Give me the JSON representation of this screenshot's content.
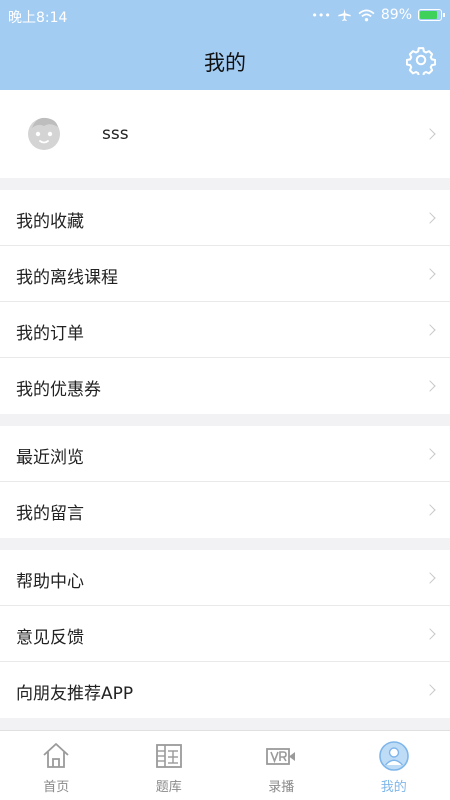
{
  "status_bar": {
    "time": "晚上8:14",
    "dots": "•••",
    "battery": "89%",
    "battery_level": 0.89
  },
  "header": {
    "title": "我的"
  },
  "profile": {
    "username": "sss"
  },
  "groups": [
    {
      "items": [
        {
          "label": "我的收藏"
        },
        {
          "label": "我的离线课程"
        },
        {
          "label": "我的订单"
        },
        {
          "label": "我的优惠券"
        }
      ]
    },
    {
      "items": [
        {
          "label": "最近浏览"
        },
        {
          "label": "我的留言"
        }
      ]
    },
    {
      "items": [
        {
          "label": "帮助中心"
        },
        {
          "label": "意见反馈"
        },
        {
          "label": "向朋友推荐APP"
        }
      ]
    }
  ],
  "tabs": [
    {
      "label": "首页",
      "icon": "home-icon"
    },
    {
      "label": "题库",
      "icon": "question-bank-icon"
    },
    {
      "label": "录播",
      "icon": "video-icon"
    },
    {
      "label": "我的",
      "icon": "profile-icon",
      "active": true
    }
  ],
  "colors": {
    "header_bg": "#a3ccf3",
    "active_tab": "#7fb6ea",
    "battery": "#3fd25a"
  }
}
